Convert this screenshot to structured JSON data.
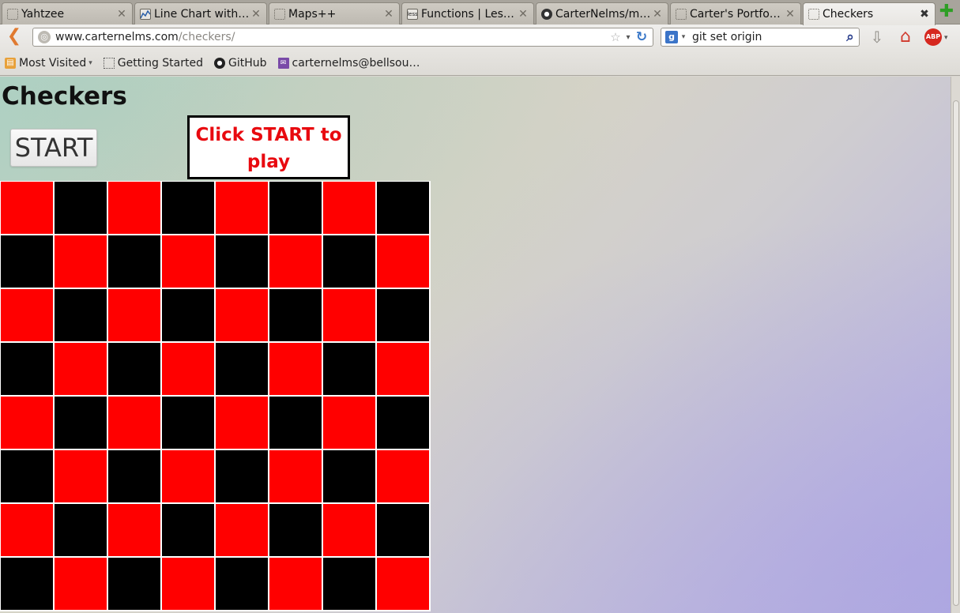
{
  "browser": {
    "tabs": [
      {
        "label": "Yahtzee",
        "icon": "page-icon"
      },
      {
        "label": "Line Chart with …",
        "icon": "chart-favicon-icon"
      },
      {
        "label": "Maps++",
        "icon": "page-icon"
      },
      {
        "label": "Functions | Less.js",
        "icon": "less-favicon-icon"
      },
      {
        "label": "CarterNelms/m…",
        "icon": "github-favicon-icon"
      },
      {
        "label": "Carter's Portfo…",
        "icon": "page-icon"
      },
      {
        "label": "Checkers",
        "icon": "page-icon"
      }
    ],
    "close_glyph": "✕",
    "active_close_glyph": "✖",
    "new_tab_glyph": "✚",
    "url_host": "www.carternelms.com",
    "url_path": "/checkers/",
    "search_query": "git set origin",
    "search_engine_glyph": "g",
    "bookmarks": [
      {
        "label": "Most Visited",
        "icon": "folder-icon",
        "dropdown": true
      },
      {
        "label": "Getting Started",
        "icon": "page-icon"
      },
      {
        "label": "GitHub",
        "icon": "github-icon"
      },
      {
        "label": "carternelms@bellsou…",
        "icon": "mail-icon"
      }
    ]
  },
  "page": {
    "title": "Checkers",
    "start_button": "START",
    "message": "Click START to play",
    "message_color": "#e8090f",
    "board": {
      "colors": {
        "red": "#ff0000",
        "black": "#000000"
      },
      "rows": [
        [
          "red",
          "black",
          "red",
          "black",
          "red",
          "black",
          "red",
          "black"
        ],
        [
          "black",
          "red",
          "black",
          "red",
          "black",
          "red",
          "black",
          "red"
        ],
        [
          "red",
          "black",
          "red",
          "black",
          "red",
          "black",
          "red",
          "black"
        ],
        [
          "black",
          "red",
          "black",
          "red",
          "black",
          "red",
          "black",
          "red"
        ],
        [
          "red",
          "black",
          "red",
          "black",
          "red",
          "black",
          "red",
          "black"
        ],
        [
          "black",
          "red",
          "black",
          "red",
          "black",
          "red",
          "black",
          "red"
        ],
        [
          "red",
          "black",
          "red",
          "black",
          "red",
          "black",
          "red",
          "black"
        ],
        [
          "black",
          "red",
          "black",
          "red",
          "black",
          "red",
          "black",
          "red"
        ]
      ]
    }
  }
}
